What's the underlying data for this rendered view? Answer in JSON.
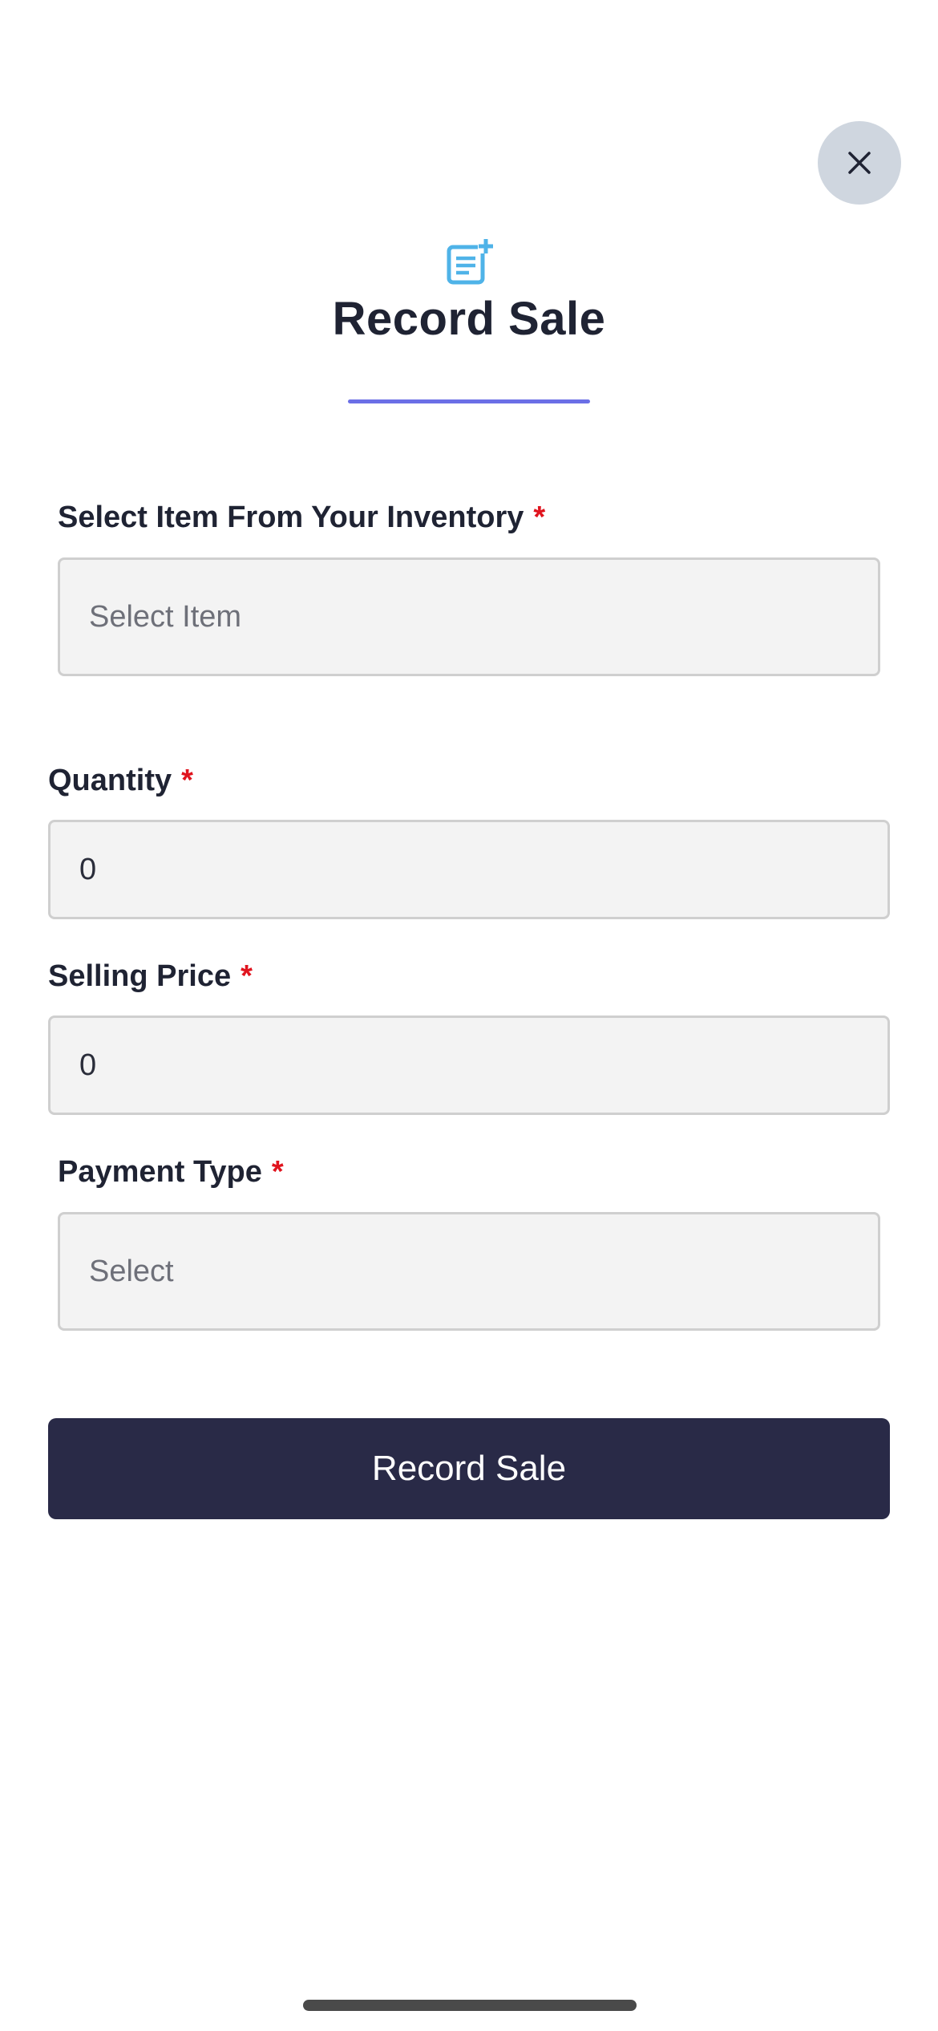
{
  "header": {
    "title": "Record Sale",
    "icon": "note-add-icon",
    "icon_color": "#4fb3e8",
    "accent_color": "#6b6fe6"
  },
  "close_icon": "close-icon",
  "form": {
    "item": {
      "label": "Select Item From Your Inventory",
      "required_mark": "*",
      "placeholder": "Select Item"
    },
    "quantity": {
      "label": "Quantity",
      "required_mark": "*",
      "value": "0"
    },
    "selling_price": {
      "label": "Selling Price",
      "required_mark": "*",
      "value": "0"
    },
    "payment_type": {
      "label": "Payment Type",
      "required_mark": "*",
      "placeholder": "Select"
    }
  },
  "submit": {
    "label": "Record Sale",
    "color": "#292a47"
  }
}
